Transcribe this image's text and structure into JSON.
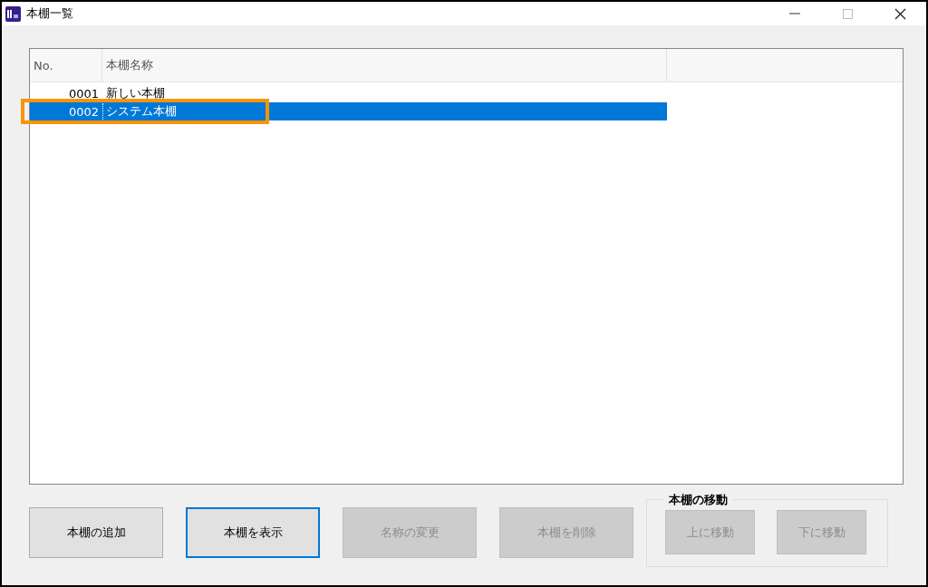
{
  "window": {
    "title": "本棚一覧"
  },
  "table": {
    "columns": [
      "No.",
      "本棚名称"
    ],
    "rows": [
      {
        "no": "0001",
        "name": "新しい本棚",
        "selected": false,
        "highlighted": false
      },
      {
        "no": "0002",
        "name": "システム本棚",
        "selected": true,
        "highlighted": true
      }
    ]
  },
  "buttons": [
    {
      "label": "本棚の追加",
      "disabled": false,
      "focused": false
    },
    {
      "label": "本棚を表示",
      "disabled": false,
      "focused": true
    },
    {
      "label": "名称の変更",
      "disabled": true,
      "focused": false
    },
    {
      "label": "本棚を削除",
      "disabled": true,
      "focused": false
    }
  ],
  "move_group": {
    "title": "本棚の移動",
    "buttons": [
      {
        "label": "上に移動",
        "disabled": true
      },
      {
        "label": "下に移動",
        "disabled": true
      }
    ]
  }
}
